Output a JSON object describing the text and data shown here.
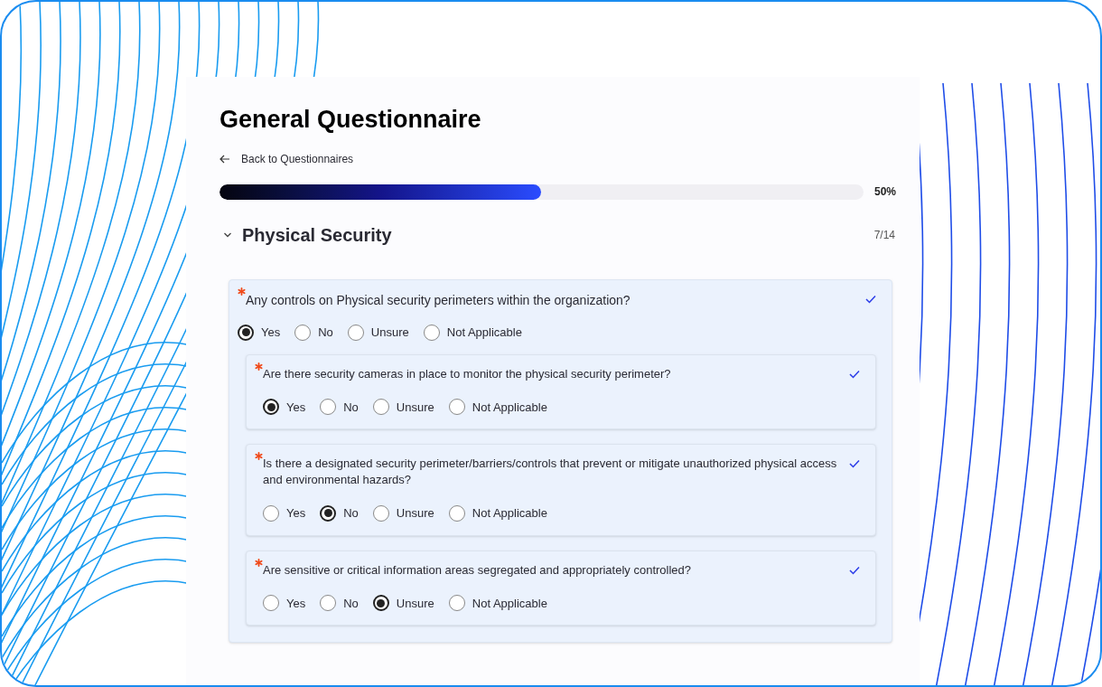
{
  "title": "General Questionnaire",
  "back_link": "Back to Questionnaires",
  "progress": {
    "level": 0.5,
    "reading": "50%"
  },
  "section": {
    "title": "Physical Security",
    "expanded": true,
    "count": "7/14"
  },
  "question": {
    "text": "Any controls on Physical security perimeters within the organization?",
    "required": true,
    "answered": true,
    "options": [
      {
        "label": "Yes",
        "selected": true
      },
      {
        "label": "No",
        "selected": false
      },
      {
        "label": "Unsure",
        "selected": false
      },
      {
        "label": "Not Applicable",
        "selected": false
      }
    ],
    "sub_questions": [
      {
        "text": "Are there security cameras in place to monitor the physical security perimeter?",
        "required": true,
        "answered": true,
        "options": [
          {
            "label": "Yes",
            "selected": true
          },
          {
            "label": "No",
            "selected": false
          },
          {
            "label": "Unsure",
            "selected": false
          },
          {
            "label": "Not Applicable",
            "selected": false
          }
        ]
      },
      {
        "text": "Is there a designated security perimeter/barriers/controls that prevent or mitigate unauthorized physical access and environmental hazards?",
        "required": true,
        "answered": true,
        "options": [
          {
            "label": "Yes",
            "selected": false
          },
          {
            "label": "No",
            "selected": true
          },
          {
            "label": "Unsure",
            "selected": false
          },
          {
            "label": "Not Applicable",
            "selected": false
          }
        ]
      },
      {
        "text": "Are sensitive or critical information areas segregated and appropriately controlled?",
        "required": true,
        "answered": true,
        "options": [
          {
            "label": "Yes",
            "selected": false
          },
          {
            "label": "No",
            "selected": false
          },
          {
            "label": "Unsure",
            "selected": true
          },
          {
            "label": "Not Applicable",
            "selected": false
          }
        ]
      }
    ]
  }
}
